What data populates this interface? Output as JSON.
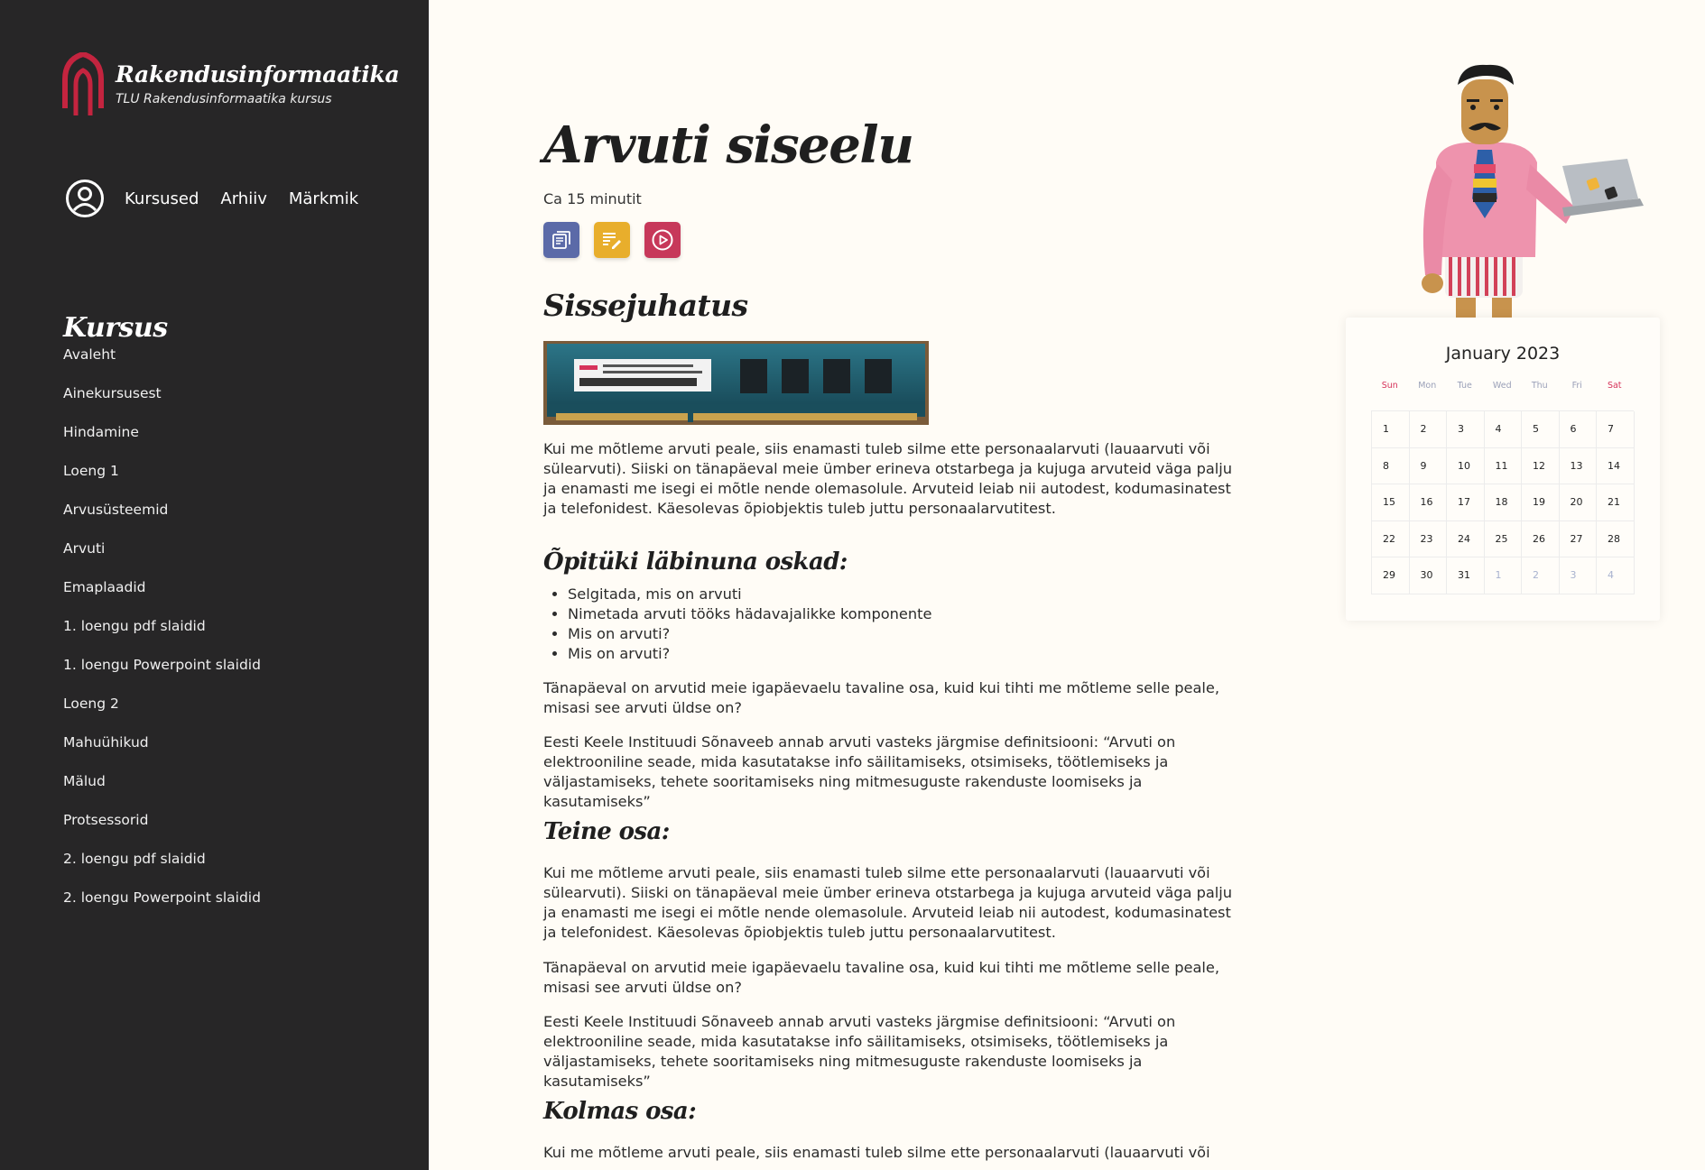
{
  "brand": {
    "title": "Rakendusinformaatika",
    "subtitle": "TLU Rakendusinformaatika kursus",
    "accent_color": "#c4243f"
  },
  "topnav": {
    "user_icon": "user-circle-icon",
    "links": [
      "Kursused",
      "Arhiiv",
      "Märkmik"
    ]
  },
  "sidebar": {
    "heading": "Kursus",
    "items": [
      "Avaleht",
      "Ainekursusest",
      "Hindamine",
      "Loeng 1",
      "Arvusüsteemid",
      "Arvuti",
      "Emaplaadid",
      "1. loengu pdf slaidid",
      "1. loengu Powerpoint slaidid",
      "Loeng 2",
      "Mahuühikud",
      "Mälud",
      "Protsessorid",
      "2. loengu pdf slaidid",
      "2. loengu Powerpoint slaidid"
    ]
  },
  "article": {
    "title": "Arvuti siseelu",
    "reading_time": "Ca 15 minutit",
    "actions": [
      {
        "icon": "article-icon",
        "color": "#5b6aa8"
      },
      {
        "icon": "notes-edit-icon",
        "color": "#e8ae2c"
      },
      {
        "icon": "play-circle-icon",
        "color": "#c7385a"
      }
    ],
    "intro_heading": "Sissejuhatus",
    "intro_paragraph": "Kui me mõtleme arvuti peale, siis enamasti tuleb silme ette personaalarvuti (lauaarvuti või sülearvuti). Siiski on tänapäeval meie ümber erineva otstarbega ja kujuga arvuteid väga palju ja enamasti me isegi ei mõtle nende olemasolule. Arvuteid leiab nii autodest, kodumasinatest ja telefonidest. Käesolevas õpiobjektis tuleb juttu personaalarvutitest.",
    "skills_heading": "Õpitüki läbinuna oskad:",
    "skills": [
      "Selgitada, mis on arvuti",
      "Nimetada arvuti tööks hädavajalikke komponente",
      "Mis on arvuti?",
      "Mis on arvuti?"
    ],
    "para_today": "Tänapäeval on arvutid meie igapäevaelu tavaline osa, kuid kui tihti me mõtleme selle peale, misasi see arvuti üldse on?",
    "para_definition": "Eesti Keele Instituudi Sõnaveeb annab arvuti vasteks järgmise definitsiooni: “Arvuti on elektrooniline seade, mida kasutatakse info säilitamiseks, otsimiseks, töötlemiseks ja väljastamiseks, tehete sooritamiseks ning mitmesuguste rakenduste loomiseks ja kasutamiseks”",
    "second_heading": "Teine osa:",
    "third_heading": "Kolmas osa:",
    "third_paragraph_start": "Kui me mõtleme arvuti peale, siis enamasti tuleb silme ette personaalarvuti (lauaarvuti või"
  },
  "calendar": {
    "title": "January 2023",
    "weekdays": [
      "Sun",
      "Mon",
      "Tue",
      "Wed",
      "Thu",
      "Fri",
      "Sat"
    ],
    "days": [
      "1",
      "2",
      "3",
      "4",
      "5",
      "6",
      "7",
      "8",
      "9",
      "10",
      "11",
      "12",
      "13",
      "14",
      "15",
      "16",
      "17",
      "18",
      "19",
      "20",
      "21",
      "22",
      "23",
      "24",
      "25",
      "26",
      "27",
      "28",
      "29",
      "30",
      "31",
      "1",
      "2",
      "3",
      "4"
    ],
    "next_month_days_from_index": 31
  }
}
